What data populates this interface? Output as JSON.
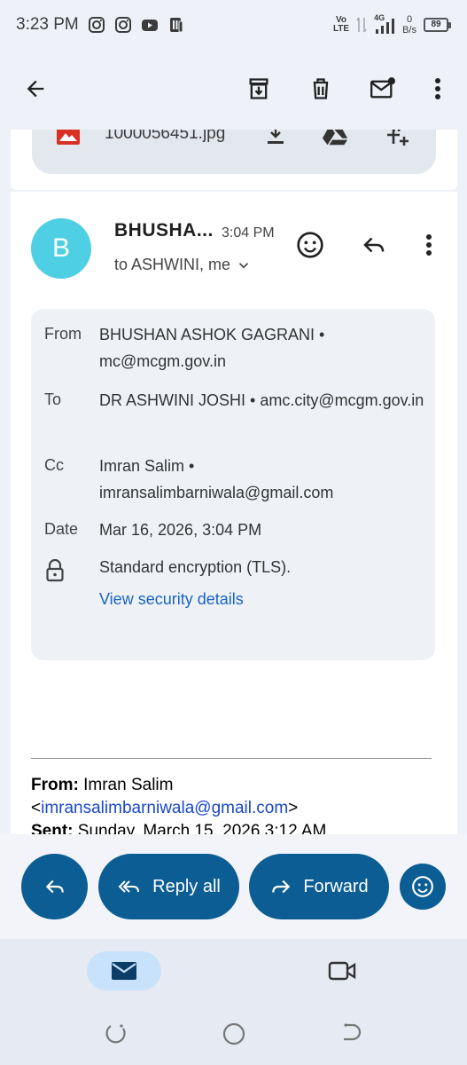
{
  "status_bar": {
    "time": "3:23 PM",
    "volte_top": "Vo",
    "volte_bottom": "LTE",
    "network": "4G",
    "speed_value": "0",
    "speed_unit": "B/s",
    "battery": "89"
  },
  "toolbar": {
    "icons": [
      "back-arrow-icon",
      "archive-icon",
      "delete-icon",
      "mark-unread-icon",
      "more-vert-icon"
    ]
  },
  "attachment": {
    "filename": "1000056451.jpg"
  },
  "message": {
    "avatar_letter": "B",
    "sender": "BHUSHA...",
    "time": "3:04 PM",
    "recipients": "to ASHWINI, me"
  },
  "details": {
    "from_label": "From",
    "from_value": "BHUSHAN ASHOK GAGRANI • mc@mcgm.gov.in",
    "to_label": "To",
    "to_value": "DR ASHWINI JOSHI • amc.city@mcgm.gov.in",
    "cc_label": "Cc",
    "cc_value": "Imran Salim • imransalimbarniwala@gmail.com",
    "date_label": "Date",
    "date_value": "Mar 16, 2026, 3:04 PM",
    "encryption": "Standard encryption (TLS).",
    "security_link": "View security details"
  },
  "quoted": {
    "from_label": "From:",
    "from_name": "Imran Salim",
    "from_open": "<",
    "from_email": "imransalimbarniwala@gmail.com",
    "from_close": ">",
    "sent_label": "Sent:",
    "sent_value": "Sunday, March 15, 2026 3:12 AM"
  },
  "actions": {
    "reply_all": "Reply all",
    "forward": "Forward"
  },
  "colors": {
    "accent": "#0b5d94",
    "avatar": "#4fcfe3",
    "link": "#1a63c2"
  }
}
